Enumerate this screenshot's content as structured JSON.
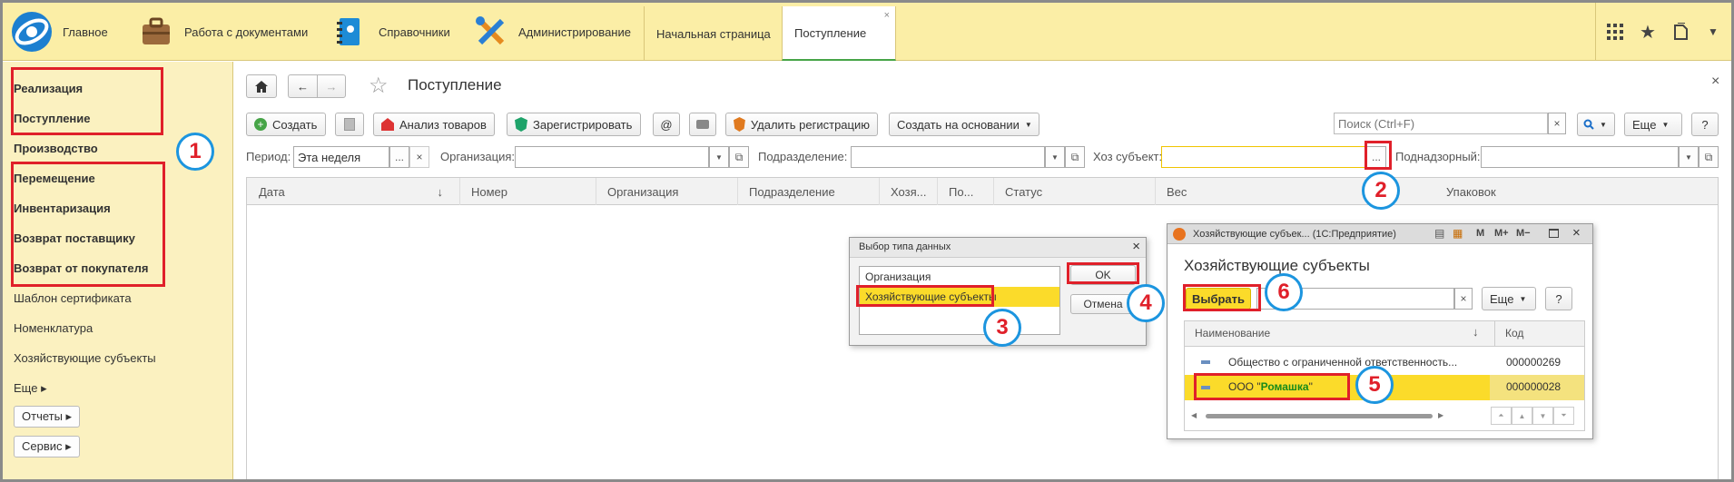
{
  "topbar": {
    "sections": [
      {
        "label": "Главное",
        "icon": "logo-icon"
      },
      {
        "label": "Работа с документами",
        "icon": "briefcase-icon"
      },
      {
        "label": "Справочники",
        "icon": "book-icon"
      },
      {
        "label": "Администрирование",
        "icon": "tools-icon"
      }
    ],
    "tabs": [
      {
        "label": "Начальная страница"
      },
      {
        "label": "Поступление",
        "close": "×"
      }
    ],
    "right_icons": [
      "grid-icon",
      "star-icon",
      "history-icon",
      "dropdown-icon"
    ]
  },
  "sidebar": {
    "items": [
      {
        "label": "Реализация",
        "bold": true
      },
      {
        "label": "Поступление",
        "bold": true
      },
      {
        "label": "Производство",
        "bold": true
      },
      {
        "label": "Перемещение",
        "bold": true
      },
      {
        "label": "Инвентаризация",
        "bold": true
      },
      {
        "label": "Возврат поставщику",
        "bold": true
      },
      {
        "label": "Возврат от покупателя",
        "bold": true
      },
      {
        "label": "Шаблон сертификата",
        "bold": false
      },
      {
        "label": "Номенклатура",
        "bold": false
      },
      {
        "label": "Хозяйствующие субъекты",
        "bold": false
      },
      {
        "label": "Еще ▸",
        "bold": false
      }
    ],
    "buttons": [
      "Отчеты ▸",
      "Сервис ▸"
    ]
  },
  "main": {
    "title": "Поступление",
    "close": "×",
    "toolbar": {
      "create": "Создать",
      "analysis": "Анализ товаров",
      "register": "Зарегистрировать",
      "at": "@",
      "delete_reg": "Удалить регистрацию",
      "create_based": "Создать на основании",
      "search_placeholder": "Поиск (Ctrl+F)",
      "search_clear": "×",
      "more": "Еще",
      "help": "?"
    },
    "filters": {
      "period_label": "Период:",
      "period_value": "Эта неделя",
      "org_label": "Организация:",
      "dept_label": "Подразделение:",
      "subject_label": "Хоз субъект:",
      "subject_btn": "...",
      "supervised_label": "Поднадзорный:"
    },
    "columns": [
      "Дата",
      "Номер",
      "Организация",
      "Подразделение",
      "Хозя...",
      "По...",
      "Статус",
      "Вес",
      "Упаковок"
    ]
  },
  "dialog_type": {
    "title": "Выбор типа данных",
    "items": [
      "Организация",
      "Хозяйствующие субъекты"
    ],
    "ok": "OK",
    "cancel": "Отмена",
    "close": "×"
  },
  "dialog_subjects": {
    "window_title": "Хозяйствующие субъек... (1С:Предприятие)",
    "heading": "Хозяйствующие субъекты",
    "select": "Выбрать",
    "more": "Еще",
    "help": "?",
    "search_clear": "×",
    "col_name": "Наименование",
    "col_code": "Код",
    "rows": [
      {
        "name": "Общество с ограниченной ответственность...",
        "code": "000000269"
      },
      {
        "name_prefix": "ООО \"",
        "name_hl": "Ромашка",
        "name_suffix": "\"",
        "code": "000000028"
      }
    ],
    "win_buttons": [
      "M",
      "M+",
      "M−"
    ]
  },
  "callouts": [
    "1",
    "2",
    "3",
    "4",
    "5",
    "6"
  ],
  "colors": {
    "accent_yellow": "#fbeea6",
    "highlight": "#fbdb2a",
    "red": "#e0202a",
    "blue": "#1c95df"
  }
}
